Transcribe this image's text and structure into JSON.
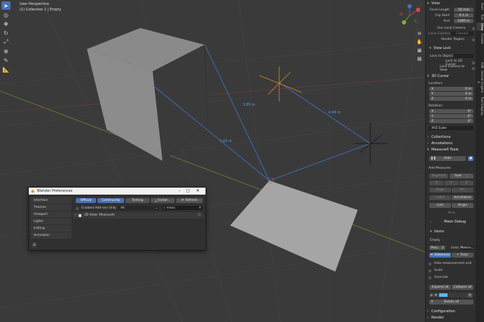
{
  "viewport": {
    "mode": "User Perspective",
    "collection": "(1) Collection 1 | Empty",
    "measures": [
      "3.85 m",
      "4.48 m",
      "5.82 m"
    ]
  },
  "tools": [
    "cursor-select",
    "cursor-3d",
    "move",
    "rotate",
    "scale",
    "transform",
    "annotate",
    "measure"
  ],
  "tabs": [
    "Item",
    "Tool",
    "View",
    "Create",
    "Edit",
    "Unreal Engine 4",
    "Tool Display"
  ],
  "view": {
    "header": "View",
    "focal_label": "Focal Length",
    "focal_value": "50 mm",
    "clip_start_label": "Clip Start",
    "clip_start_value": "0.1 m",
    "end_label": "End",
    "end_value": "1000 m",
    "use_local_camera": "Use Local Camera",
    "local_camera_label": "Local Camera",
    "local_camera_value": "Camera",
    "render_region": "Render Region"
  },
  "view_lock": {
    "header": "View Lock",
    "lock_to_object": "Lock to Object",
    "lock_3d_cursor": "Lock to 3D Cursor",
    "lock_camera": "Lock Camera to View"
  },
  "cursor": {
    "header": "3D Cursor",
    "location_label": "Location:",
    "loc": [
      {
        "axis": "X",
        "value": "0 m"
      },
      {
        "axis": "Y",
        "value": "0 m"
      },
      {
        "axis": "Z",
        "value": "0 m"
      }
    ],
    "rotation_label": "Rotation:",
    "rot": [
      {
        "axis": "X",
        "value": "0°"
      },
      {
        "axis": "Y",
        "value": "0°"
      },
      {
        "axis": "Z",
        "value": "0°"
      }
    ],
    "mode": "XYZ Euler"
  },
  "collapsed": [
    "Collections",
    "Annotations"
  ],
  "measureit": {
    "header": "MeasureIt Tools",
    "hide": "Hide",
    "add_measures": "Add Measures",
    "segment": "Segment",
    "sum": "Sum",
    "xyz": [
      "X",
      "Y",
      "Z"
    ],
    "angle": "Angle",
    "arc": "Arc",
    "label": "Label",
    "annotation": "Annotation",
    "link": "Link",
    "origin": "Origin",
    "area": "Area",
    "mesh_debug": "Mesh Debug"
  },
  "items": {
    "header": "Items",
    "object": "Empty",
    "prec_label": "Prec:",
    "prec_value": "2",
    "units_label": "Units",
    "units_value": "Meters",
    "distances": "Distances",
    "texts": "Texts",
    "hide_unit": "Hide measurement unit",
    "scale": "Scale",
    "override": "Override",
    "expand_all": "Expand all",
    "collapse_all": "Collapse all",
    "delete_all": "Delete all"
  },
  "footer": [
    "Configuration",
    "Render"
  ],
  "prefs": {
    "title": "Blender Preferences",
    "sidebar": [
      "Interface",
      "Themes",
      "Viewport",
      "Lights",
      "Editing",
      "Animation"
    ],
    "btn_official": "Official",
    "btn_community": "Community",
    "btn_testing": "Testing",
    "btn_install": "Install...",
    "btn_refresh": "Refresh",
    "enabled_only": "Enabled Add-ons Only",
    "category": "All",
    "search": "meas",
    "addon": "3D View: MeasureIt"
  }
}
